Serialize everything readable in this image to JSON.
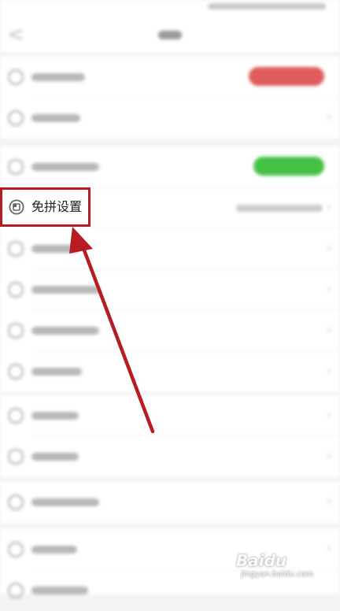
{
  "highlighted_item": {
    "label": "免拼设置",
    "icon": "square-in-circle-icon"
  },
  "annotation": {
    "box_color": "#b71c22",
    "arrow_color": "#b71c22"
  },
  "watermark": {
    "brand": "Baidu",
    "sub": "jingyan.baidu.com"
  }
}
